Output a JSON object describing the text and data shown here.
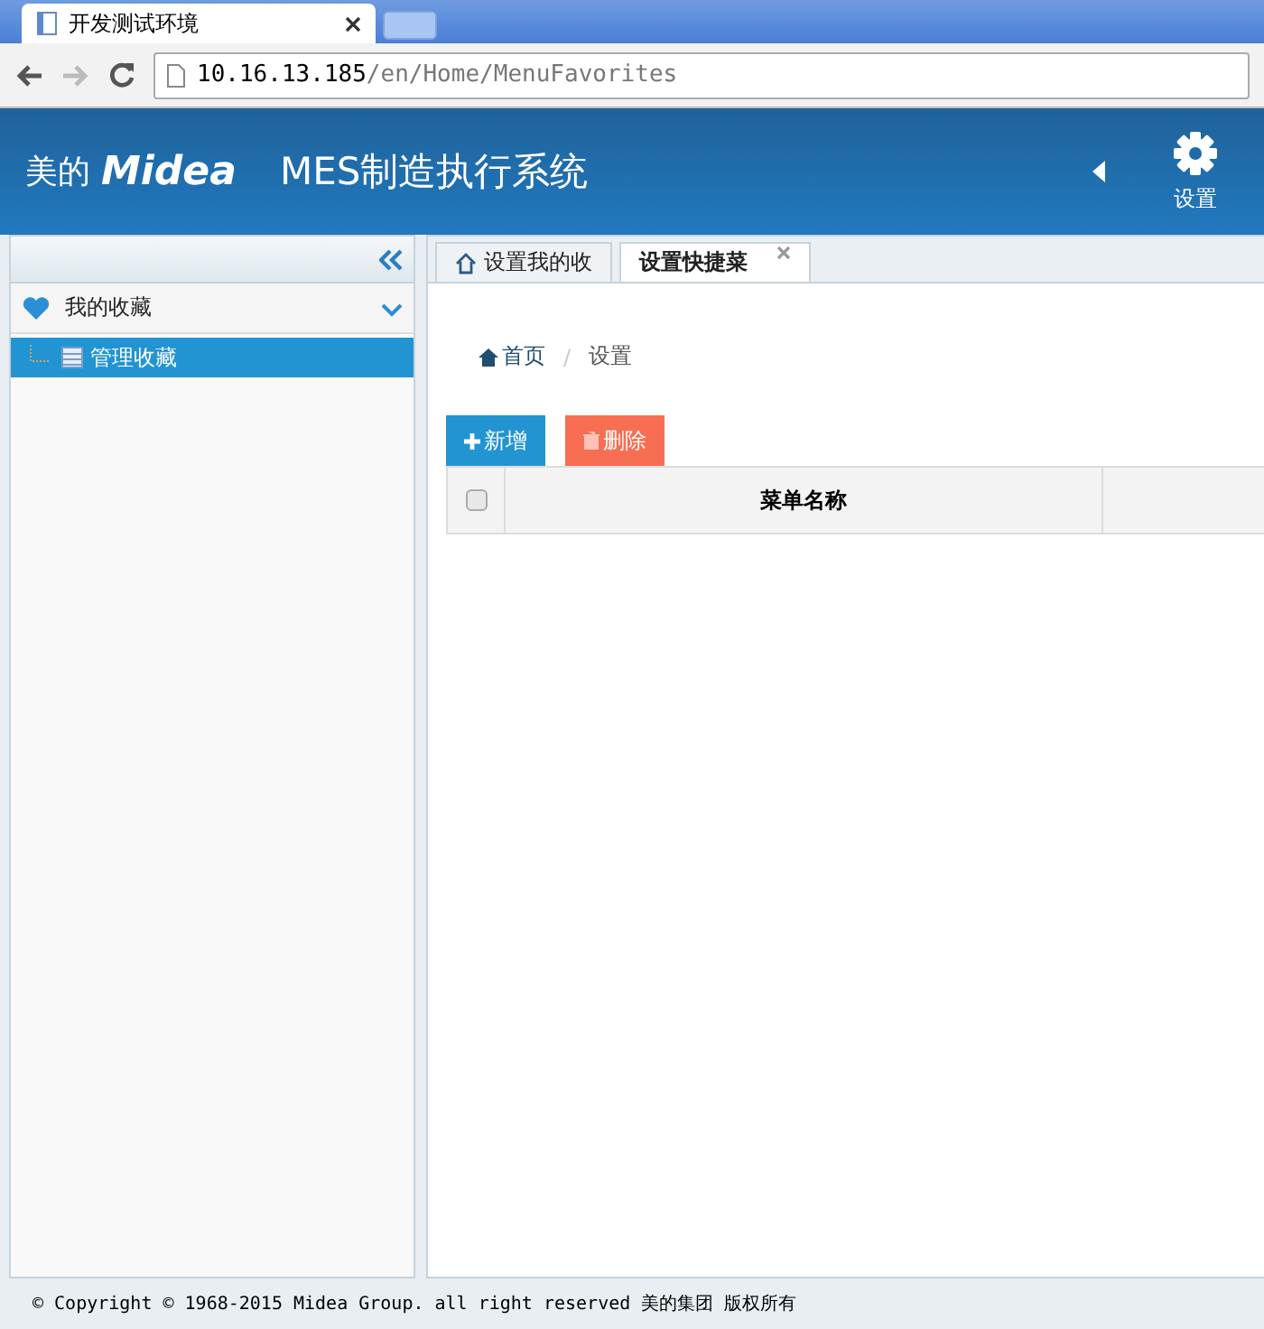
{
  "browser": {
    "tab_title": "开发测试环境",
    "url_host": "10.16.13.185",
    "url_path": "/en/Home/MenuFavorites"
  },
  "header": {
    "brand": "美的",
    "logo": "Midea",
    "title": "MES制造执行系统",
    "settings_label": "设置"
  },
  "sidebar": {
    "groups": [
      {
        "label": "我的收藏",
        "expanded": true,
        "children": [
          {
            "label": "管理收藏",
            "selected": true
          }
        ]
      }
    ]
  },
  "tabs": [
    {
      "label": "设置我的收",
      "selected": false,
      "kind": "home"
    },
    {
      "label": "设置快捷菜",
      "selected": true,
      "kind": "closable"
    }
  ],
  "breadcrumb": {
    "items": [
      "首页",
      "设置"
    ],
    "separator": "/"
  },
  "buttons": [
    {
      "label": "新增",
      "kind": "add"
    },
    {
      "label": "删除",
      "kind": "delete"
    }
  ],
  "table": {
    "select_all_checked": false,
    "columns": [
      "菜单名称"
    ]
  },
  "footer": "© Copyright © 1968-2015 Midea Group. all right reserved 美的集团 版权所有"
}
